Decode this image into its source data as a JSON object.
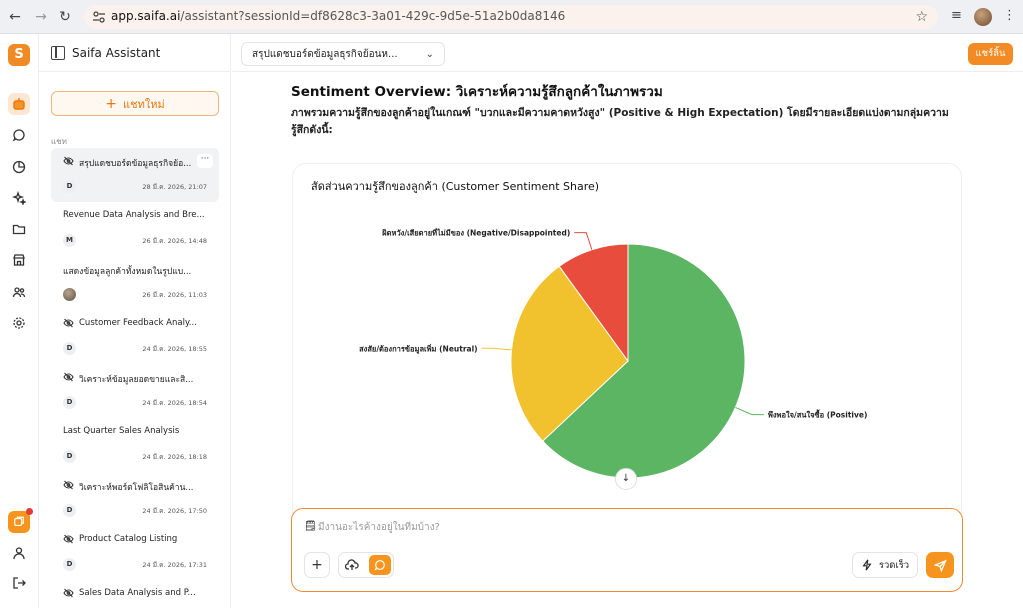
{
  "browser": {
    "url_host": "app.saifa.ai",
    "url_path": "/assistant?sessionId=df8628c3-3a01-429c-9d5e-51a2b0da8146"
  },
  "sidebar": {
    "title": "Saifa Assistant",
    "new_chat_label": "แชทใหม่",
    "section_label": "แชท",
    "chats": [
      {
        "title": "สรุปแดชบอร์ดข้อมูลธุรกิจย้อ...",
        "avatar": "D",
        "date": "28 มี.ค. 2026, 21:07",
        "hidden_icon": true,
        "selected": true
      },
      {
        "title": "Revenue Data Analysis and Bre...",
        "avatar": "M",
        "date": "26 มี.ค. 2026, 14:48",
        "hidden_icon": false,
        "selected": false
      },
      {
        "title": "แสดงข้อมูลลูกค้าทั้งหมดในรูปแบ...",
        "avatar": "",
        "date": "26 มี.ค. 2026, 11:03",
        "hidden_icon": false,
        "selected": false,
        "photo": true
      },
      {
        "title": "Customer Feedback Analy...",
        "avatar": "D",
        "date": "24 มี.ค. 2026, 18:55",
        "hidden_icon": true,
        "selected": false
      },
      {
        "title": "วิเคราะห์ข้อมูลยอดขายและสิ...",
        "avatar": "D",
        "date": "24 มี.ค. 2026, 18:54",
        "hidden_icon": true,
        "selected": false
      },
      {
        "title": "Last Quarter Sales Analysis",
        "avatar": "D",
        "date": "24 มี.ค. 2026, 18:18",
        "hidden_icon": false,
        "selected": false
      },
      {
        "title": "วิเคราะห์พอร์ตโฟลิโอสินค้าน...",
        "avatar": "D",
        "date": "24 มี.ค. 2026, 17:50",
        "hidden_icon": true,
        "selected": false
      },
      {
        "title": "Product Catalog Listing",
        "avatar": "D",
        "date": "24 มี.ค. 2026, 17:31",
        "hidden_icon": true,
        "selected": false
      },
      {
        "title": "Sales Data Analysis and P...",
        "avatar": "D",
        "date": "",
        "hidden_icon": true,
        "selected": false
      }
    ]
  },
  "topbar": {
    "conversation_title": "สรุปแดชบอร์ดข้อมูลธุรกิจย้อนห...",
    "share_label": "แชร์ลิ้น"
  },
  "content": {
    "heading": "Sentiment Overview: วิเคราะห์ความรู้สึกลูกค้าในภาพรวม",
    "paragraph": "ภาพรวมความรู้สึกของลูกค้าอยู่ในเกณฑ์ \"บวกและมีความคาดหวังสูง\" (Positive & High Expectation) โดยมีรายละเอียดแบ่งตามกลุ่มความรู้สึกดังนี้:"
  },
  "chart_data": {
    "type": "pie",
    "title": "สัดส่วนความรู้สึกของลูกค้า (Customer Sentiment Share)",
    "slices": [
      {
        "label": "พึงพอใจ/สนใจซื้อ (Positive)",
        "value": 63,
        "color": "#5bb562"
      },
      {
        "label": "สงสัย/ต้องการข้อมูลเพิ่ม (Neutral)",
        "value": 27,
        "color": "#f2c12e"
      },
      {
        "label": "ผิดหวัง/เสียดายที่ไม่มีของ (Negative/Disappointed)",
        "value": 10,
        "color": "#e74c3c"
      }
    ]
  },
  "composer": {
    "placeholder": "มีงานอะไรค้างอยู่ในทีมบ้าง?",
    "speed_label": "รวดเร็ว"
  },
  "colors": {
    "accent": "#f38b24",
    "positive": "#5bb562",
    "neutral": "#f2c12e",
    "negative": "#e74c3c"
  },
  "icons": [
    "back-icon",
    "forward-icon",
    "reload-icon",
    "site-info-icon",
    "star-icon",
    "cast-icon",
    "menu-icon",
    "bot-icon",
    "chat-icon",
    "pie-chart-icon",
    "sparkle-icon",
    "folder-icon",
    "store-icon",
    "people-icon",
    "settings-icon",
    "profile-icon",
    "logout-icon",
    "eye-off-icon",
    "plus-icon",
    "cloud-upload-icon",
    "lightning-icon",
    "send-icon",
    "arrow-down-icon"
  ]
}
